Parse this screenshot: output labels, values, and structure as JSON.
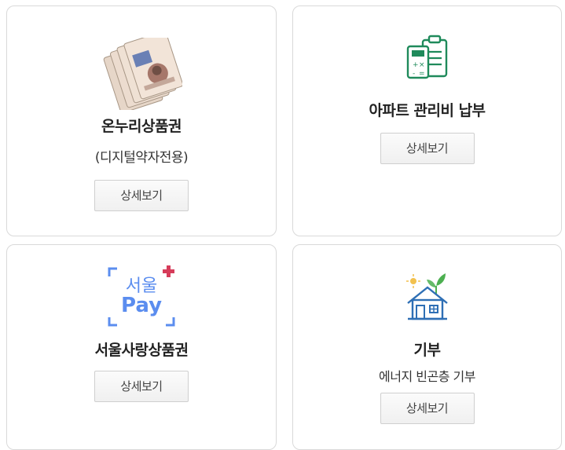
{
  "cards": [
    {
      "title": "온누리상품권",
      "subtitle": "(디지털약자전용)",
      "button": "상세보기",
      "icon": "banknotes-icon"
    },
    {
      "title": "아파트 관리비 납부",
      "button": "상세보기",
      "icon": "calculator-clipboard-icon"
    },
    {
      "title": "서울사랑상품권",
      "button": "상세보기",
      "icon": "seoul-pay-logo",
      "logo_text": {
        "top": "서울",
        "bottom": "Pay"
      }
    },
    {
      "title": "기부",
      "subtitle": "에너지 빈곤층 기부",
      "button": "상세보기",
      "icon": "house-sprout-icon"
    }
  ],
  "colors": {
    "card_border": "#d9d9d9",
    "icon_green": "#1f8a5b",
    "house_blue": "#2e6fb5",
    "sprout_green": "#4caf50",
    "seoul_pay_blue": "#5b8def",
    "seoul_pay_red": "#d63c5a"
  }
}
